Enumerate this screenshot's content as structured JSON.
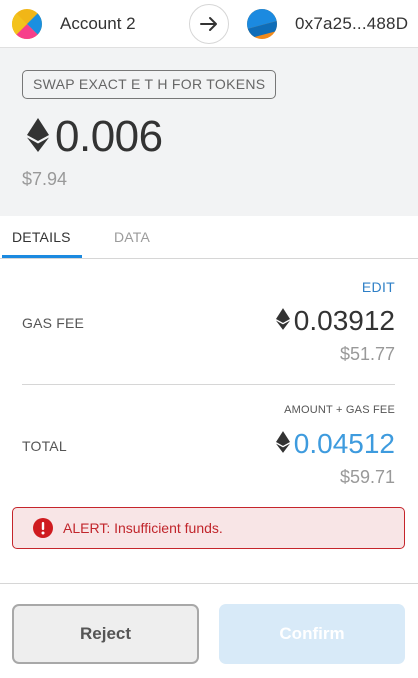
{
  "header": {
    "from_account": "Account 2",
    "to_address": "0x7a25...488D"
  },
  "summary": {
    "method": "SWAP EXACT E T H FOR TOKENS",
    "amount": "0.006",
    "fiat": "$7.94"
  },
  "tabs": [
    {
      "label": "DETAILS",
      "active": true
    },
    {
      "label": "DATA",
      "active": false
    }
  ],
  "details": {
    "edit_label": "EDIT",
    "gas_fee": {
      "label": "GAS FEE",
      "eth": "0.03912",
      "fiat": "$51.77"
    },
    "total": {
      "caption": "AMOUNT + GAS FEE",
      "label": "TOTAL",
      "eth": "0.04512",
      "fiat": "$59.71"
    }
  },
  "alert": {
    "text": "ALERT: Insufficient funds."
  },
  "buttons": {
    "reject": "Reject",
    "confirm": "Confirm"
  },
  "colors": {
    "accent": "#1b8ae0",
    "total_value": "#3e9bde",
    "alert_border": "#c5252b",
    "alert_bg": "#f8e5e6",
    "confirm_disabled": "#d8eaf8"
  },
  "icons": {
    "from_avatar": "from-identicon",
    "to_avatar": "to-identicon",
    "transfer_arrow": "arrow-right-icon",
    "currency": "ethereum-icon",
    "alert": "exclamation-circle-icon"
  }
}
